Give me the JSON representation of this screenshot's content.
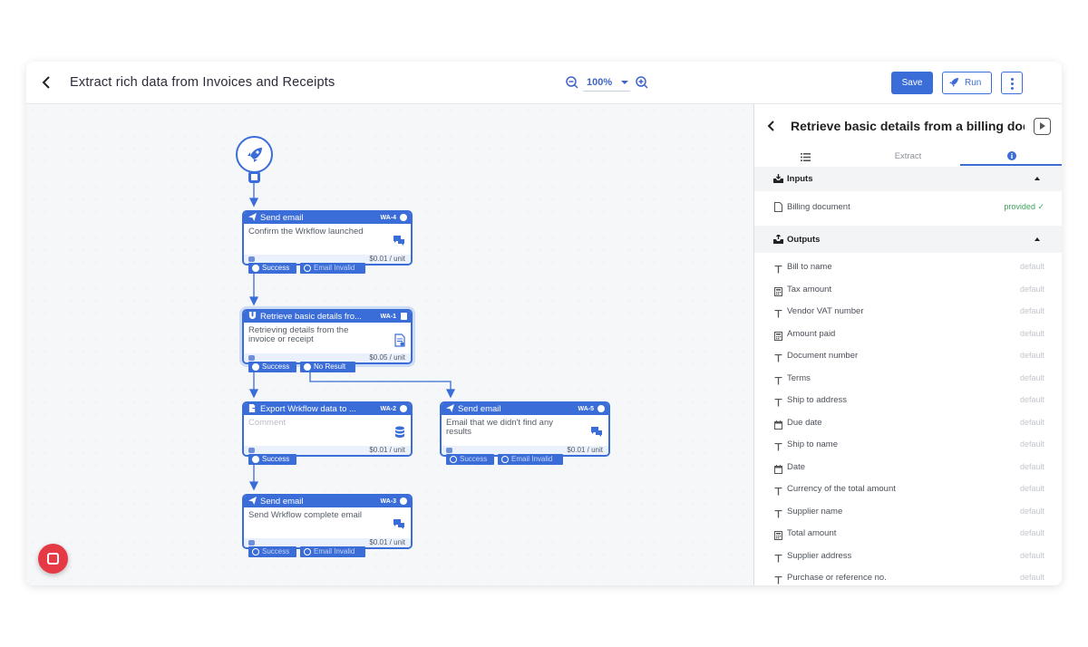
{
  "header": {
    "title": "Extract rich data from Invoices and Receipts",
    "zoom": "100%",
    "save_label": "Save",
    "run_label": "Run"
  },
  "nodes": [
    {
      "title": "Send email",
      "id": "WA-4",
      "body": "Confirm the Wrkflow launched",
      "price": "$0.01 / unit",
      "ports": [
        "Success",
        "Email Invalid"
      ]
    },
    {
      "title": "Retrieve basic details fro...",
      "id": "WA-1",
      "body": "Retrieving details from the invoice or receipt",
      "price": "$0.05 / unit",
      "ports": [
        "Success",
        "No Result"
      ]
    },
    {
      "title": "Export Wrkflow data to ...",
      "id": "WA-2",
      "body": "Comment",
      "price": "$0.01 / unit",
      "ports": [
        "Success"
      ]
    },
    {
      "title": "Send email",
      "id": "WA-5",
      "body": "Email that we didn't find any results",
      "price": "$0.01 / unit",
      "ports": [
        "Success",
        "Email Invalid"
      ]
    },
    {
      "title": "Send email",
      "id": "WA-3",
      "body": "Send Wrkflow complete email",
      "price": "$0.01 / unit",
      "ports": [
        "Success",
        "Email Invalid"
      ]
    }
  ],
  "panel": {
    "title": "Retrieve basic details from a billing document",
    "tabs": [
      "",
      "Extract",
      ""
    ],
    "inputs_label": "Inputs",
    "outputs_label": "Outputs",
    "inputs": [
      {
        "label": "Billing document",
        "status": "provided ✓"
      }
    ],
    "outputs": [
      {
        "label": "Bill to name",
        "icon": "text-icon",
        "value": "default"
      },
      {
        "label": "Tax amount",
        "icon": "calculator-icon",
        "value": "default"
      },
      {
        "label": "Vendor VAT number",
        "icon": "text-icon",
        "value": "default"
      },
      {
        "label": "Amount paid",
        "icon": "calculator-icon",
        "value": "default"
      },
      {
        "label": "Document number",
        "icon": "text-icon",
        "value": "default"
      },
      {
        "label": "Terms",
        "icon": "text-icon",
        "value": "default"
      },
      {
        "label": "Ship to address",
        "icon": "text-icon",
        "value": "default"
      },
      {
        "label": "Due date",
        "icon": "calendar-icon",
        "value": "default"
      },
      {
        "label": "Ship to name",
        "icon": "text-icon",
        "value": "default"
      },
      {
        "label": "Date",
        "icon": "calendar-icon",
        "value": "default"
      },
      {
        "label": "Currency of the total amount",
        "icon": "text-icon",
        "value": "default"
      },
      {
        "label": "Supplier name",
        "icon": "text-icon",
        "value": "default"
      },
      {
        "label": "Total amount",
        "icon": "calculator-icon",
        "value": "default"
      },
      {
        "label": "Supplier address",
        "icon": "text-icon",
        "value": "default"
      },
      {
        "label": "Purchase or reference no.",
        "icon": "text-icon",
        "value": "default"
      }
    ]
  },
  "colors": {
    "accent": "#3b6dd8",
    "success": "#3aa55a",
    "launcher": "#e63946"
  }
}
